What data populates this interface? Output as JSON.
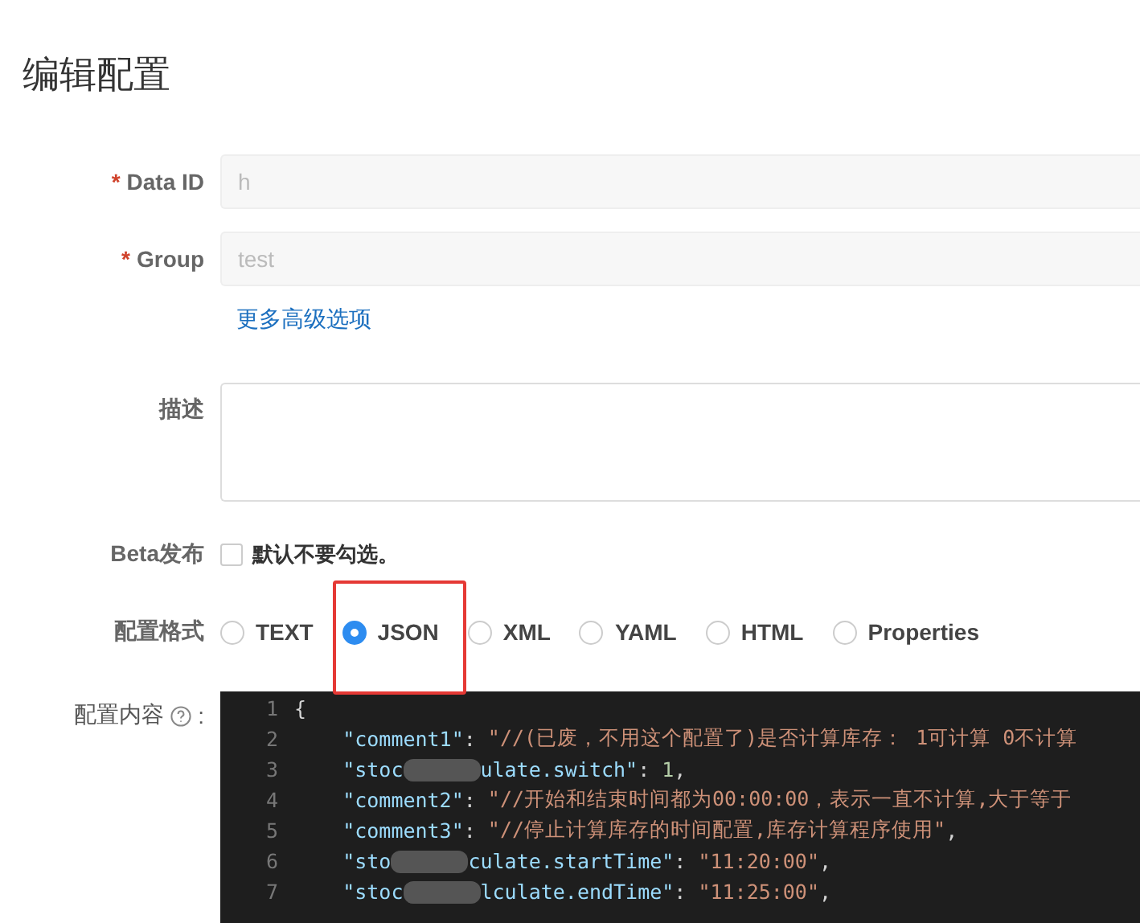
{
  "title": "编辑配置",
  "fields": [
    {
      "label": "Data ID",
      "mark": "*",
      "kind": "input",
      "value": "h"
    },
    {
      "label": "Group",
      "mark": "*",
      "kind": "input",
      "value": "test"
    },
    {
      "kind": "link",
      "text": "更多高级选项"
    },
    {
      "label": "描述",
      "kind": "textarea"
    },
    {
      "label": "Beta发布",
      "kind": "checkbox",
      "checked": false,
      "text": "默认不要勾选。"
    },
    {
      "label": "配置格式",
      "kind": "radios",
      "options": [
        {
          "label": "TEXT",
          "selected": false
        },
        {
          "label": "JSON",
          "selected": true
        },
        {
          "label": "XML",
          "selected": false
        },
        {
          "label": "YAML",
          "selected": false
        },
        {
          "label": "HTML",
          "selected": false
        },
        {
          "label": "Properties",
          "selected": false
        }
      ]
    }
  ],
  "editor": {
    "label": "配置内容",
    "suffix": ":",
    "lines": [
      {
        "number": "1",
        "tokens": [
          {
            "kind": "punct",
            "text": "{"
          }
        ]
      },
      {
        "number": "2",
        "tokens": [
          {
            "kind": "key",
            "text": "    \"comment1\""
          },
          {
            "kind": "punct",
            "text": ": "
          },
          {
            "kind": "string",
            "text": "\"//(已废，不用这个配置了)是否计算库存： 1可计算 0不计算"
          }
        ]
      },
      {
        "number": "3",
        "tokens": [
          {
            "kind": "key",
            "text": "    \"stoc"
          },
          {
            "kind": "blur"
          },
          {
            "kind": "key",
            "text": "ulate.switch\""
          },
          {
            "kind": "punct",
            "text": ": "
          },
          {
            "kind": "number",
            "text": "1"
          },
          {
            "kind": "punct",
            "text": ","
          }
        ]
      },
      {
        "number": "4",
        "tokens": [
          {
            "kind": "key",
            "text": "    \"comment2\""
          },
          {
            "kind": "punct",
            "text": ": "
          },
          {
            "kind": "string",
            "text": "\"//开始和结束时间都为00:00:00，表示一直不计算,大于等于"
          }
        ]
      },
      {
        "number": "5",
        "tokens": [
          {
            "kind": "key",
            "text": "    \"comment3\""
          },
          {
            "kind": "punct",
            "text": ": "
          },
          {
            "kind": "string",
            "text": "\"//停止计算库存的时间配置,库存计算程序使用\""
          },
          {
            "kind": "punct",
            "text": ","
          }
        ]
      },
      {
        "number": "6",
        "tokens": [
          {
            "kind": "key",
            "text": "    \"sto"
          },
          {
            "kind": "blur"
          },
          {
            "kind": "key",
            "text": "culate.startTime\""
          },
          {
            "kind": "punct",
            "text": ": "
          },
          {
            "kind": "string",
            "text": "\"11:20:00\""
          },
          {
            "kind": "punct",
            "text": ","
          }
        ]
      },
      {
        "number": "7",
        "tokens": [
          {
            "kind": "key",
            "text": "    \"stoc"
          },
          {
            "kind": "blur"
          },
          {
            "kind": "key",
            "text": "lculate.endTime\""
          },
          {
            "kind": "punct",
            "text": ": "
          },
          {
            "kind": "string",
            "text": "\"11:25:00\""
          },
          {
            "kind": "punct",
            "text": ","
          }
        ]
      }
    ]
  }
}
